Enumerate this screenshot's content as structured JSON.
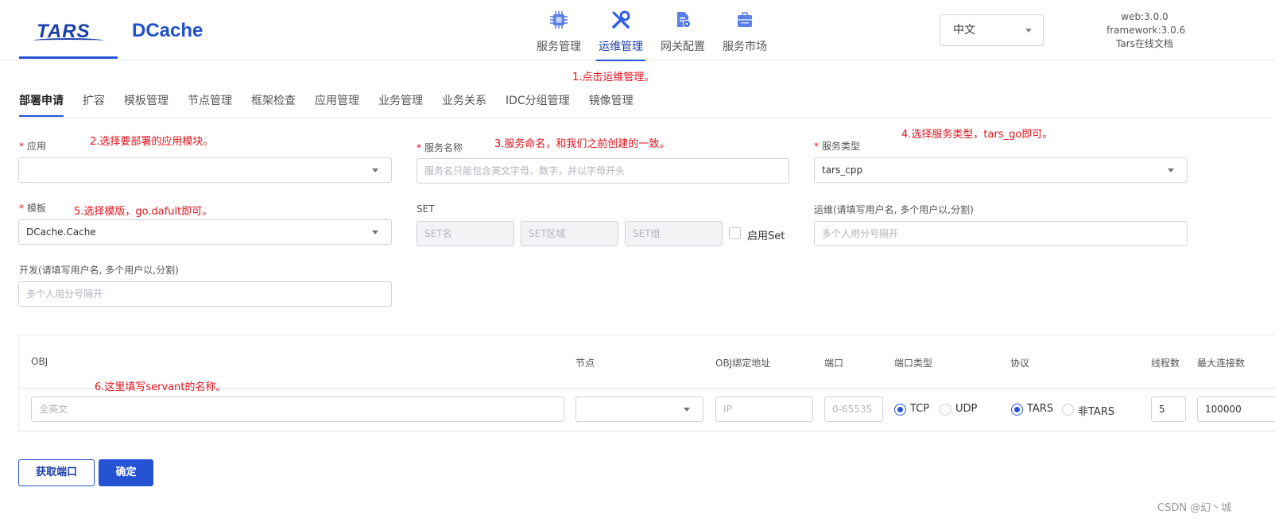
{
  "header": {
    "logo_tars": "TARS",
    "logo_dcache": "DCache",
    "nav": [
      {
        "label": "服务管理",
        "icon": "chip-icon"
      },
      {
        "label": "运维管理",
        "icon": "tools-icon"
      },
      {
        "label": "网关配置",
        "icon": "gateway-doc-icon"
      },
      {
        "label": "服务市场",
        "icon": "market-case-icon"
      }
    ],
    "active_nav": "运维管理",
    "language": "中文",
    "version": {
      "web": "web:3.0.0",
      "framework": "framework:3.0.6",
      "docs": "Tars在线文档"
    }
  },
  "notes": {
    "n1": "1.点击运维管理。",
    "n2": "2.选择要部署的应用模块。",
    "n3": "3.服务命名，和我们之前创建的一致。",
    "n4": "4.选择服务类型，tars_go即可。",
    "n5": "5.选择模版，go.dafult即可。",
    "n6": "6.这里填写servant的名称。"
  },
  "subnav": {
    "tabs": [
      "部署申请",
      "扩容",
      "模板管理",
      "节点管理",
      "框架检查",
      "应用管理",
      "业务管理",
      "业务关系",
      "IDC分组管理",
      "镜像管理"
    ],
    "active": "部署申请"
  },
  "form": {
    "app": {
      "label": "应用",
      "required": "*",
      "value": ""
    },
    "service_name": {
      "label": "服务名称",
      "required": "*",
      "placeholder": "服务名只能包含英文字母、数字，并以字母开头"
    },
    "service_type": {
      "label": "服务类型",
      "required": "*",
      "value": "tars_cpp"
    },
    "template": {
      "label": "模板",
      "required": "*",
      "value": "DCache.Cache"
    },
    "set": {
      "label": "SET",
      "name_placeholder": "SET名",
      "area_placeholder": "SET区域",
      "group_placeholder": "SET组",
      "enable_label": "启用Set",
      "enabled": false
    },
    "ops": {
      "label": "运维(请填写用户名, 多个用户以,分割)",
      "placeholder": "多个人用分号隔开"
    },
    "dev": {
      "label": "开发(请填写用户名, 多个用户以,分割)",
      "placeholder": "多个人用分号隔开"
    }
  },
  "table": {
    "headers": [
      "OBJ",
      "节点",
      "OBJ绑定地址",
      "端口",
      "端口类型",
      "协议",
      "线程数",
      "最大连接数"
    ],
    "row": {
      "obj_placeholder": "全英文",
      "node_value": "",
      "bind_placeholder": "IP",
      "port_placeholder": "0-65535",
      "port_type_options": [
        "TCP",
        "UDP"
      ],
      "port_type_selected": "TCP",
      "protocol_options": [
        "TARS",
        "非TARS"
      ],
      "protocol_selected": "TARS",
      "threads": "5",
      "max_conn": "100000"
    }
  },
  "buttons": {
    "get_port": "获取端口",
    "confirm": "确定"
  },
  "watermark": "CSDN @幻丶城",
  "colors": {
    "accent": "#2453d4",
    "note_red": "#e0141e",
    "border": "#cfd3da"
  }
}
